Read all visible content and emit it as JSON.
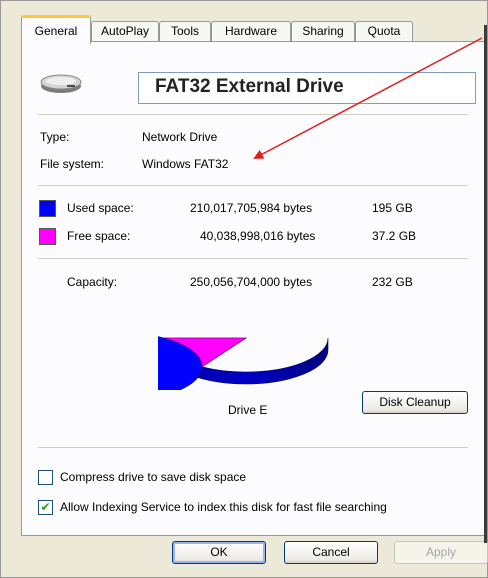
{
  "tabs": [
    "General",
    "AutoPlay",
    "Tools",
    "Hardware",
    "Sharing",
    "Quota"
  ],
  "drive_label": "FAT32 External Drive",
  "drive_icon": "hard-drive-icon",
  "type_label": "Type:",
  "type_value": "Network Drive",
  "fs_label": "File system:",
  "fs_value": "Windows FAT32",
  "used": {
    "label": "Used space:",
    "bytes": "210,017,705,984 bytes",
    "size": "195 GB",
    "color": "#0000ff"
  },
  "free": {
    "label": "Free space:",
    "bytes": "40,038,998,016 bytes",
    "size": "37.2 GB",
    "color": "#ff00ff"
  },
  "capacity": {
    "label": "Capacity:",
    "bytes": "250,056,704,000 bytes",
    "size": "232 GB"
  },
  "chart_data": {
    "type": "pie",
    "categories": [
      "Used space",
      "Free space"
    ],
    "values": [
      210017705984,
      40038998016
    ],
    "colors": [
      "#0000ff",
      "#ff00ff"
    ]
  },
  "drive_caption": "Drive E",
  "disk_cleanup_label": "Disk Cleanup",
  "compress_label": "Compress drive to save disk space",
  "compress_checked": false,
  "index_label": "Allow Indexing Service to index this disk for fast file searching",
  "index_checked": true,
  "ok_label": "OK",
  "cancel_label": "Cancel",
  "apply_label": "Apply",
  "annotation_arrow_color": "#e02020"
}
